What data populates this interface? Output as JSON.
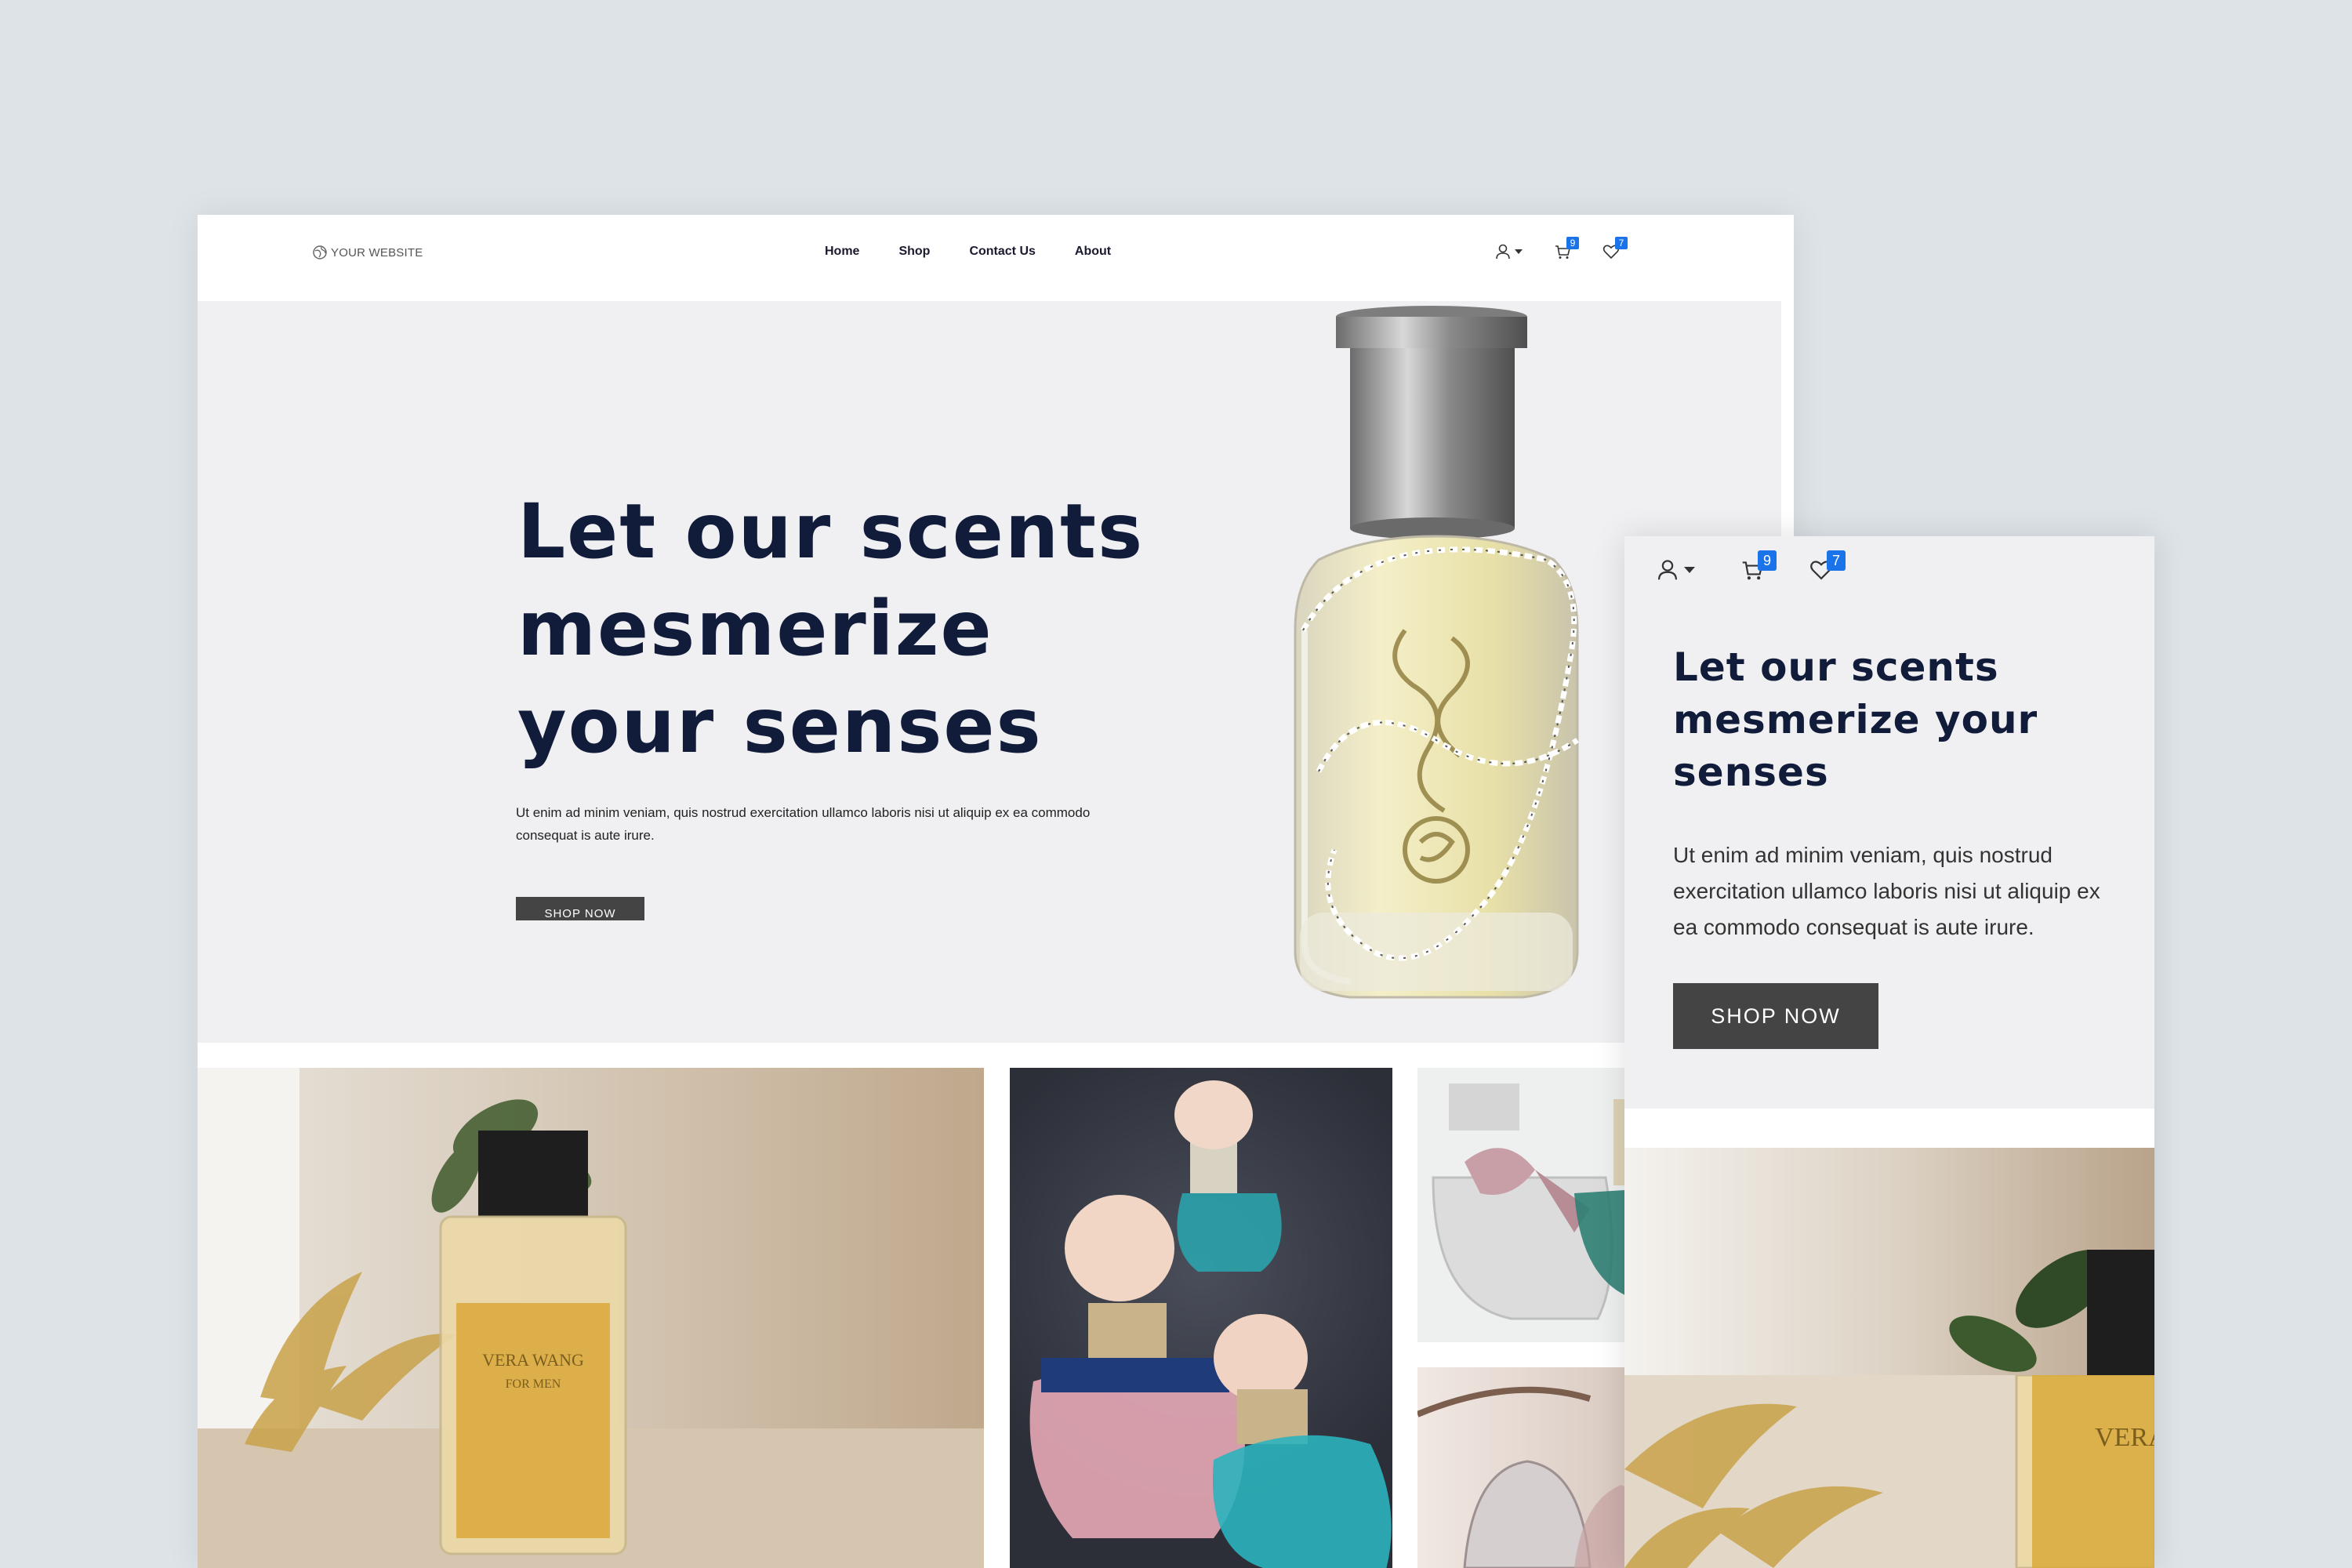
{
  "desktop": {
    "logo": {
      "text": "YOUR WEBSITE",
      "icon": "globe-icon"
    },
    "nav": [
      {
        "label": "Home"
      },
      {
        "label": "Shop"
      },
      {
        "label": "Contact Us"
      },
      {
        "label": "About"
      }
    ],
    "icons": {
      "account": "user-icon",
      "cart_count": "9",
      "wishlist_count": "7"
    },
    "hero": {
      "title": "Let our scents mesmerize your senses",
      "text": "Ut enim ad minim veniam, quis nostrud exercitation ullamco laboris nisi ut aliquip ex ea commodo consequat is aute irure.",
      "button": "SHOP NOW"
    },
    "gallery": {
      "bottle_label_line1": "VERA WANG",
      "bottle_label_line2": "FOR MEN"
    }
  },
  "mobile": {
    "icons": {
      "cart_count": "9",
      "wishlist_count": "7"
    },
    "hero": {
      "title": "Let our scents mesmerize your senses",
      "text": "Ut enim ad minim veniam, quis nostrud exercitation ullamco laboris nisi ut aliquip ex ea commodo consequat is aute irure.",
      "button": "SHOP NOW"
    },
    "label_partial": "VERA"
  },
  "colors": {
    "background": "#dde3e7",
    "hero_bg": "#f0f0f2",
    "title": "#111b3a",
    "button": "#444444",
    "badge": "#1a73e8"
  }
}
